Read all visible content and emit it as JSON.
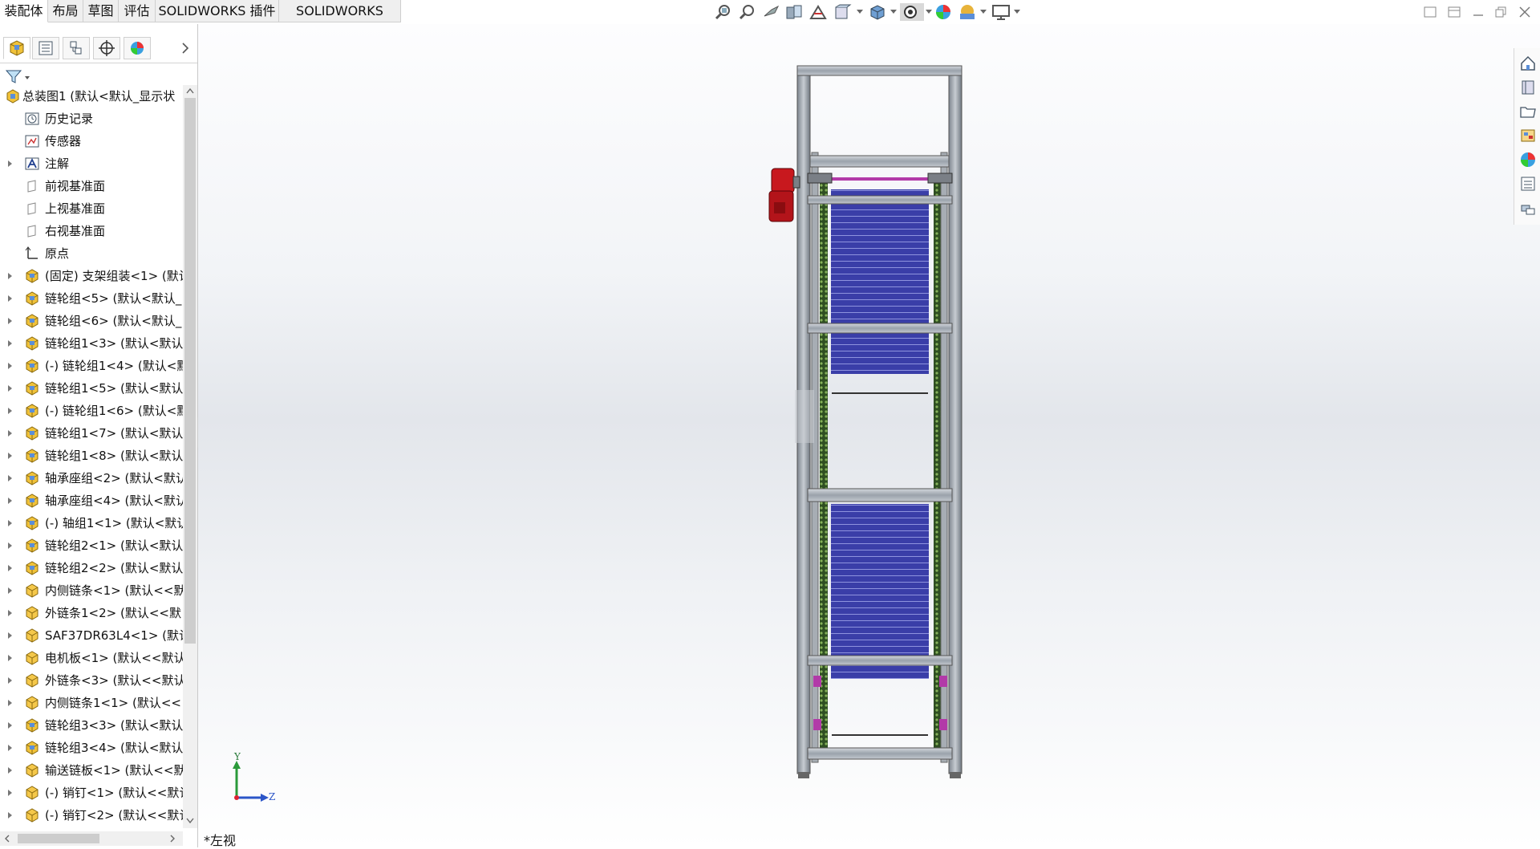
{
  "command_tabs": [
    {
      "label": "装配体",
      "active": true
    },
    {
      "label": "布局",
      "active": false
    },
    {
      "label": "草图",
      "active": false
    },
    {
      "label": "评估",
      "active": false
    },
    {
      "label": "SOLIDWORKS 插件",
      "active": false
    },
    {
      "label": "SOLIDWORKS MBD",
      "active": false
    }
  ],
  "hud_icons": [
    "zoom-to-fit-icon",
    "zoom-to-area-icon",
    "previous-view-icon",
    "section-view-icon",
    "dynamic-annotation-icon",
    "view-orientation-icon",
    "display-style-icon",
    "hide-show-icon",
    "edit-appearance-icon",
    "apply-scene-icon",
    "view-settings-icon"
  ],
  "panel_tabs": [
    "featuremanager-tab",
    "propertymanager-tab",
    "configurationmanager-tab",
    "dimxpert-tab",
    "displaymanager-tab"
  ],
  "tree": {
    "root": "总装图1 (默认<默认_显示状",
    "items": [
      {
        "label": "历史记录",
        "icon": "history-icon",
        "expandable": false
      },
      {
        "label": "传感器",
        "icon": "sensor-icon",
        "expandable": false
      },
      {
        "label": "注解",
        "icon": "annotation-icon",
        "expandable": true
      },
      {
        "label": "前视基准面",
        "icon": "plane-icon",
        "expandable": false
      },
      {
        "label": "上视基准面",
        "icon": "plane-icon",
        "expandable": false
      },
      {
        "label": "右视基准面",
        "icon": "plane-icon",
        "expandable": false
      },
      {
        "label": "原点",
        "icon": "origin-icon",
        "expandable": false
      },
      {
        "label": "(固定) 支架组装<1> (默认",
        "icon": "subassembly-icon",
        "expandable": true
      },
      {
        "label": "链轮组<5> (默认<默认_",
        "icon": "subassembly-icon",
        "expandable": true
      },
      {
        "label": "链轮组<6> (默认<默认_",
        "icon": "subassembly-icon",
        "expandable": true
      },
      {
        "label": "链轮组1<3> (默认<默认",
        "icon": "subassembly-icon",
        "expandable": true
      },
      {
        "label": "(-) 链轮组1<4> (默认<默",
        "icon": "subassembly-icon",
        "expandable": true
      },
      {
        "label": "链轮组1<5> (默认<默认",
        "icon": "subassembly-icon",
        "expandable": true
      },
      {
        "label": "(-) 链轮组1<6> (默认<默",
        "icon": "subassembly-icon",
        "expandable": true
      },
      {
        "label": "链轮组1<7> (默认<默认",
        "icon": "subassembly-icon",
        "expandable": true
      },
      {
        "label": "链轮组1<8> (默认<默认",
        "icon": "subassembly-icon",
        "expandable": true
      },
      {
        "label": "轴承座组<2> (默认<默认",
        "icon": "subassembly-icon",
        "expandable": true
      },
      {
        "label": "轴承座组<4> (默认<默认",
        "icon": "subassembly-icon",
        "expandable": true
      },
      {
        "label": "(-) 轴组1<1> (默认<默认",
        "icon": "subassembly-icon",
        "expandable": true
      },
      {
        "label": "链轮组2<1> (默认<默认",
        "icon": "subassembly-icon",
        "expandable": true
      },
      {
        "label": "链轮组2<2> (默认<默认",
        "icon": "subassembly-icon",
        "expandable": true
      },
      {
        "label": "内侧链条<1> (默认<<默",
        "icon": "part-icon",
        "expandable": true
      },
      {
        "label": "外链条1<2> (默认<<默",
        "icon": "part-icon",
        "expandable": true
      },
      {
        "label": "SAF37DR63L4<1> (默认",
        "icon": "part-icon",
        "expandable": true
      },
      {
        "label": "电机板<1> (默认<<默认",
        "icon": "part-icon",
        "expandable": true
      },
      {
        "label": "外链条<3> (默认<<默认",
        "icon": "part-icon",
        "expandable": true
      },
      {
        "label": "内侧链条1<1> (默认<<",
        "icon": "part-icon",
        "expandable": true
      },
      {
        "label": "链轮组3<3> (默认<默认",
        "icon": "subassembly-icon",
        "expandable": true
      },
      {
        "label": "链轮组3<4> (默认<默认",
        "icon": "subassembly-icon",
        "expandable": true
      },
      {
        "label": "输送链板<1> (默认<<默",
        "icon": "part-icon",
        "expandable": true
      },
      {
        "label": "(-) 销钉<1> (默认<<默认",
        "icon": "part-icon",
        "expandable": true
      },
      {
        "label": "(-) 销钉<2> (默认<<默认",
        "icon": "part-icon",
        "expandable": true
      }
    ]
  },
  "triad": {
    "y": "Y",
    "z": "Z"
  },
  "view_name": "*左视",
  "colors": {
    "accent_blue": "#2b55c8",
    "motor_red": "#c8181e",
    "frame_gray": "#9aa2ab",
    "slat_blue": "#3a3ea8",
    "chain_green": "#3f6b2a"
  }
}
